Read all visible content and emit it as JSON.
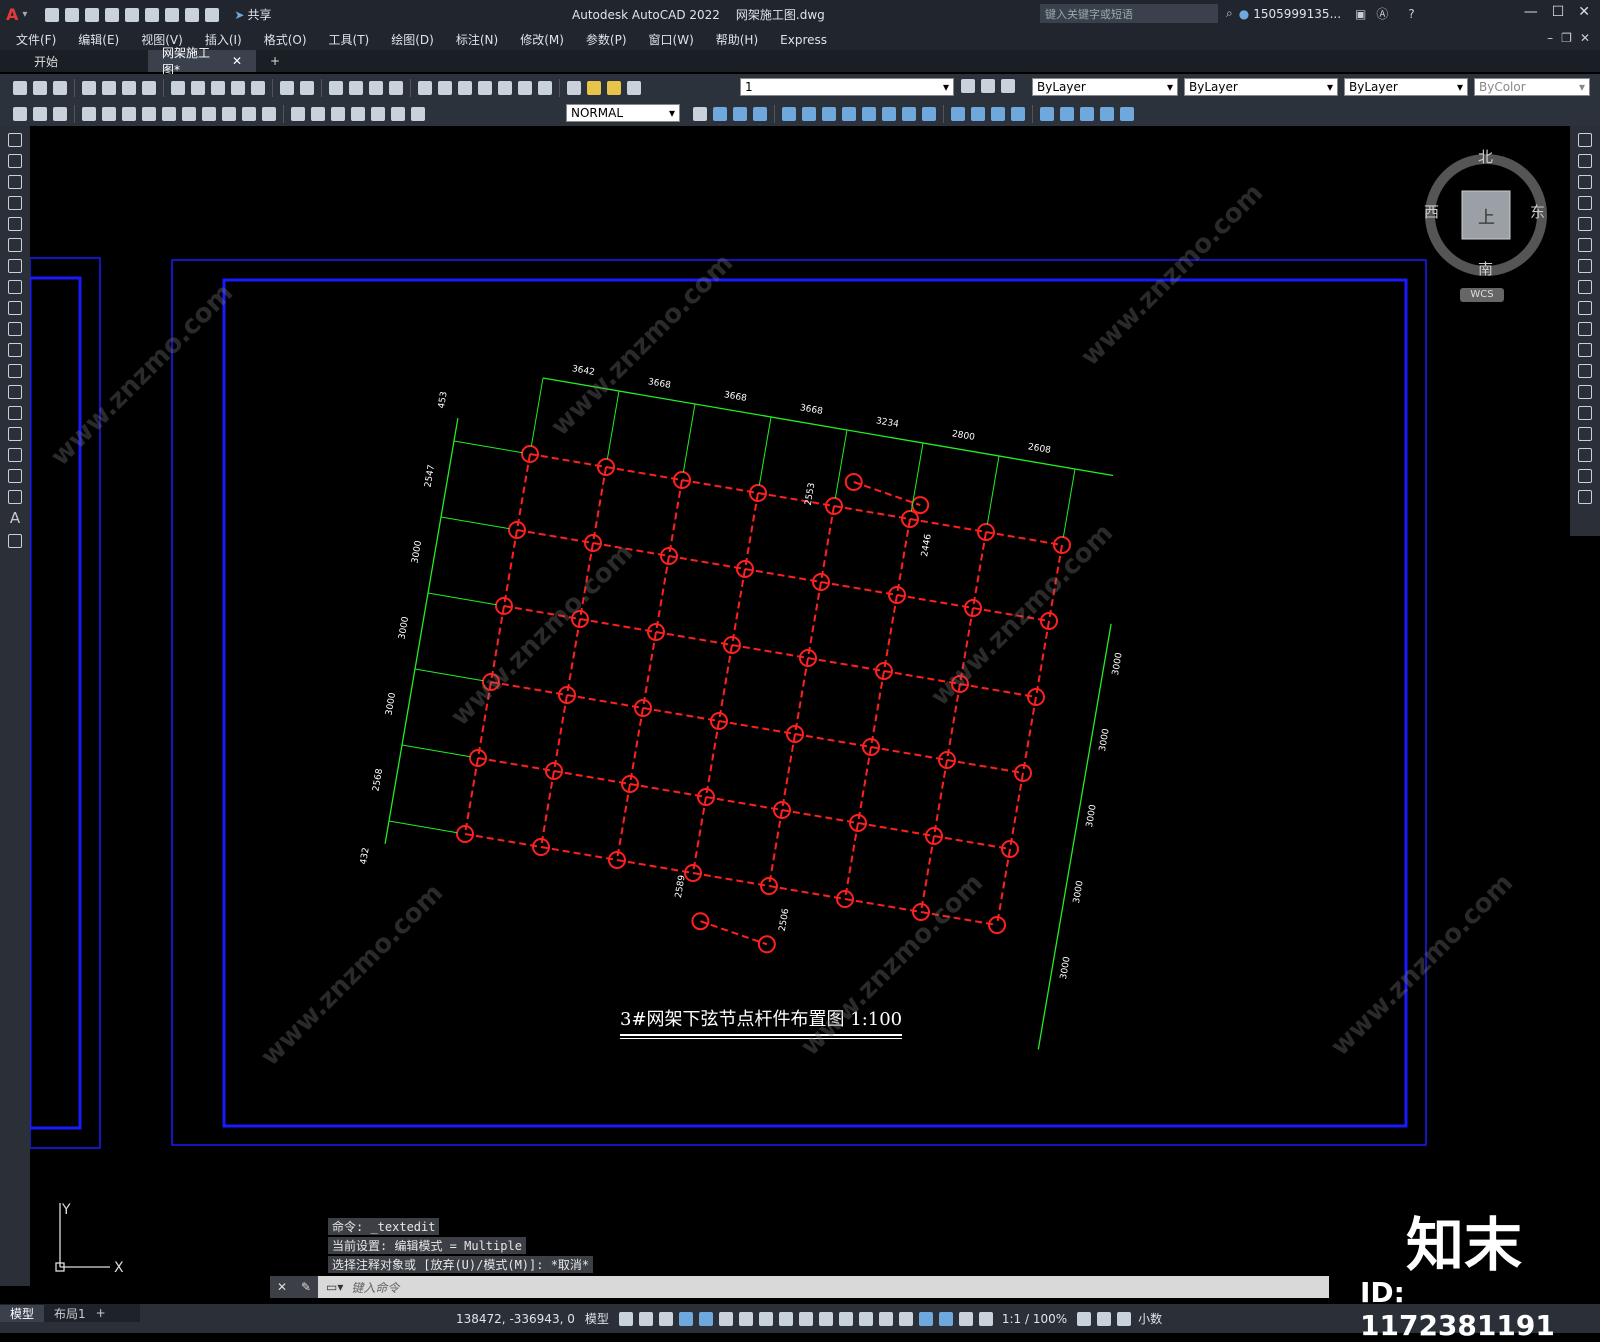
{
  "title_bar": {
    "app_title": "Autodesk AutoCAD 2022",
    "file_name": "网架施工图.dwg",
    "share_label": "共享",
    "search_placeholder": "键入关键字或短语",
    "user_name": "1505999135..."
  },
  "menu": [
    "文件(F)",
    "编辑(E)",
    "视图(V)",
    "插入(I)",
    "格式(O)",
    "工具(T)",
    "绘图(D)",
    "标注(N)",
    "修改(M)",
    "参数(P)",
    "窗口(W)",
    "帮助(H)",
    "Express"
  ],
  "tabs": [
    {
      "label": "开始"
    },
    {
      "label": "网架施工图*"
    }
  ],
  "toolbar": {
    "layer_value": "1",
    "color_value": "ByLayer",
    "linetype_value": "ByLayer",
    "lineweight_value": "ByLayer",
    "plotstyle_value": "ByColor",
    "dimstyle_value": "NORMAL"
  },
  "viewcube": {
    "north": "北",
    "south": "南",
    "east": "东",
    "west": "西",
    "top": "上",
    "wcs": "WCS"
  },
  "drawing": {
    "title": "3#网架下弦节点杆件布置图 1:100",
    "top_dims": [
      "3642",
      "3668",
      "3668",
      "3668",
      "3234",
      "2800",
      "2608"
    ],
    "left_dims": [
      "453",
      "2547",
      "3000",
      "3000",
      "3000",
      "2568",
      "432"
    ],
    "right_dims": [
      "3000",
      "3000",
      "3000",
      "3000",
      "3000"
    ],
    "misc_dims": [
      "2553",
      "2446",
      "2589",
      "2506"
    ],
    "grid_colors": {
      "nodes": "#ff2020",
      "dims": "#22ee22",
      "frame": "#1010ff"
    }
  },
  "command": {
    "history": [
      "命令: _textedit",
      "当前设置: 编辑模式 = Multiple",
      "选择注释对象或 [放弃(U)/模式(M)]: *取消*"
    ],
    "placeholder": "键入命令"
  },
  "layout_tabs": [
    "模型",
    "布局1"
  ],
  "status": {
    "coords": "138472, -336943, 0",
    "model_label": "模型",
    "scale": "1:1 / 100%",
    "units": "小数"
  },
  "watermark": {
    "brand": "知末",
    "id_text": "ID: 1172381191",
    "site": "www.znzmo.com"
  }
}
